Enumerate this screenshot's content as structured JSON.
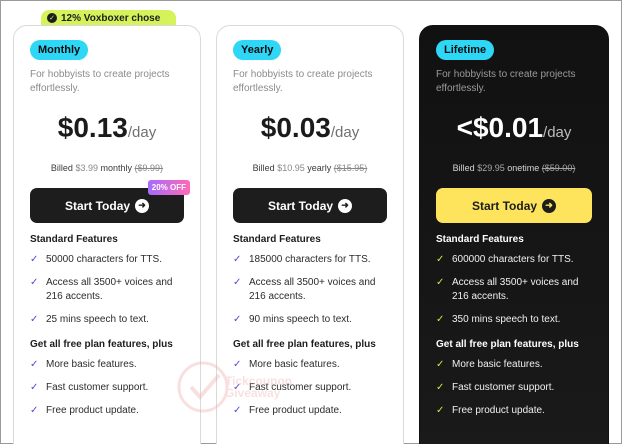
{
  "badge": {
    "text": "12% Voxboxer chose"
  },
  "plans": [
    {
      "name": "Monthly",
      "desc": "For hobbyists to create projects effortlessly.",
      "price": "$0.13",
      "per": "/day",
      "billed_prefix": "Billed",
      "billed_amount": "$3.99",
      "billed_period": "monthly",
      "billed_original": "($9.99)",
      "cta": "Start Today",
      "discount": "20% OFF",
      "standard_title": "Standard Features",
      "features": [
        "50000 characters for TTS.",
        "Access all 3500+ voices and 216 accents.",
        "25 mins speech to text."
      ],
      "extra_title": "Get all free plan features, plus",
      "extras": [
        "More basic features.",
        "Fast customer support.",
        "Free product update."
      ]
    },
    {
      "name": "Yearly",
      "desc": "For hobbyists to create projects effortlessly.",
      "price": "$0.03",
      "per": "/day",
      "billed_prefix": "Billed",
      "billed_amount": "$10.95",
      "billed_period": "yearly",
      "billed_original": "($15.95)",
      "cta": "Start Today",
      "standard_title": "Standard Features",
      "features": [
        "185000 characters for TTS.",
        "Access all 3500+ voices and 216 accents.",
        "90 mins speech to text."
      ],
      "extra_title": "Get all free plan features, plus",
      "extras": [
        "More basic features.",
        "Fast customer support.",
        "Free product update."
      ]
    },
    {
      "name": "Lifetime",
      "desc": "For hobbyists to create projects effortlessly.",
      "price": "<$0.01",
      "per": "/day",
      "billed_prefix": "Billed",
      "billed_amount": "$29.95",
      "billed_period": "onetime",
      "billed_original": "($59.00)",
      "cta": "Start Today",
      "standard_title": "Standard Features",
      "features": [
        "600000 characters for TTS.",
        "Access all 3500+ voices and 216 accents.",
        "350 mins speech to text."
      ],
      "extra_title": "Get all free plan features, plus",
      "extras": [
        "More basic features.",
        "Fast customer support.",
        "Free product update."
      ]
    }
  ],
  "watermark": {
    "line1": "Tickcoupon",
    "line2": "Giveaway"
  },
  "icons": {
    "check": "check-icon",
    "arrow": "arrow-right-icon"
  },
  "colors": {
    "pill": "#2ed7f5",
    "cta_dark": "#1d1d1d",
    "cta_yellow": "#fde45c",
    "badge": "#d6f25a",
    "tick_purple": "#4b4bd8",
    "tick_green": "#c4ec3e"
  }
}
